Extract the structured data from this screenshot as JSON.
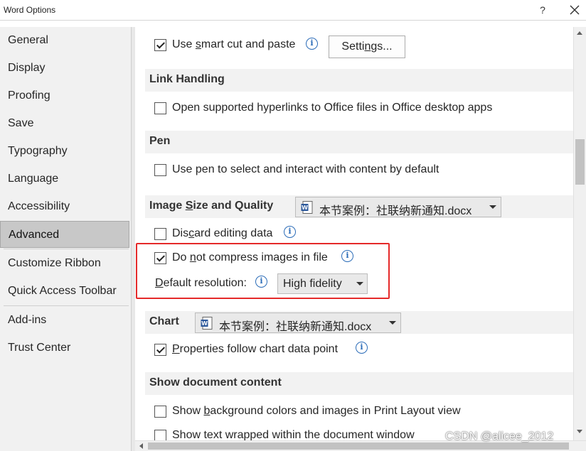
{
  "window": {
    "title": "Word Options",
    "help_label": "?"
  },
  "sidebar": {
    "items": [
      {
        "label": "General"
      },
      {
        "label": "Display"
      },
      {
        "label": "Proofing"
      },
      {
        "label": "Save"
      },
      {
        "label": "Typography"
      },
      {
        "label": "Language"
      },
      {
        "label": "Accessibility"
      },
      {
        "label": "Advanced",
        "selected": true
      },
      {
        "label": "Customize Ribbon"
      },
      {
        "label": "Quick Access Toolbar"
      },
      {
        "label": "Add-ins"
      },
      {
        "label": "Trust Center"
      }
    ]
  },
  "content": {
    "smart_cut": {
      "pre": "Use ",
      "u": "s",
      "post": "mart cut and paste",
      "checked": true
    },
    "settings_button": {
      "pre": "Setti",
      "u": "n",
      "post": "gs..."
    },
    "link_handling": {
      "title": "Link Handling",
      "option": {
        "label": "Open supported hyperlinks to Office files in Office desktop apps",
        "checked": false
      }
    },
    "pen": {
      "title": "Pen",
      "option": {
        "label": "Use pen to select and interact with content by default",
        "checked": false
      }
    },
    "image_quality": {
      "title_pre": "Image ",
      "title_u": "S",
      "title_post": "ize and Quality",
      "document": "本节案例：社联纳新通知.docx",
      "discard": {
        "pre": "Dis",
        "u": "c",
        "post": "ard editing data",
        "checked": false
      },
      "no_compress": {
        "pre": "Do ",
        "u": "n",
        "post": "ot compress images in file",
        "checked": true
      },
      "resolution_label": {
        "u": "D",
        "post": "efault resolution:"
      },
      "resolution_value": "High fidelity"
    },
    "chart": {
      "title": "Chart",
      "document": "本节案例：社联纳新通知.docx",
      "option": {
        "u": "P",
        "post": "roperties follow chart data point",
        "checked": true
      }
    },
    "show_document": {
      "title": "Show document content",
      "bg_colors": {
        "pre": "Show ",
        "u": "b",
        "post": "ackground colors and images in Print Layout view",
        "checked": false
      },
      "text_wrapped": {
        "label": "Show text wrapped within the document window",
        "checked": false
      }
    }
  },
  "watermark": "CSDN @alicee_2012",
  "colors": {
    "accent_blue": "#2b6cb8",
    "highlight_red": "#e52a2a",
    "sidebar_bg": "#f1f1f1",
    "selected_bg": "#c8c8c8",
    "section_bg": "#f2f2f2"
  },
  "icons": [
    "help-icon",
    "close-icon",
    "info-icon",
    "word-doc-icon",
    "dropdown-arrow-icon"
  ]
}
